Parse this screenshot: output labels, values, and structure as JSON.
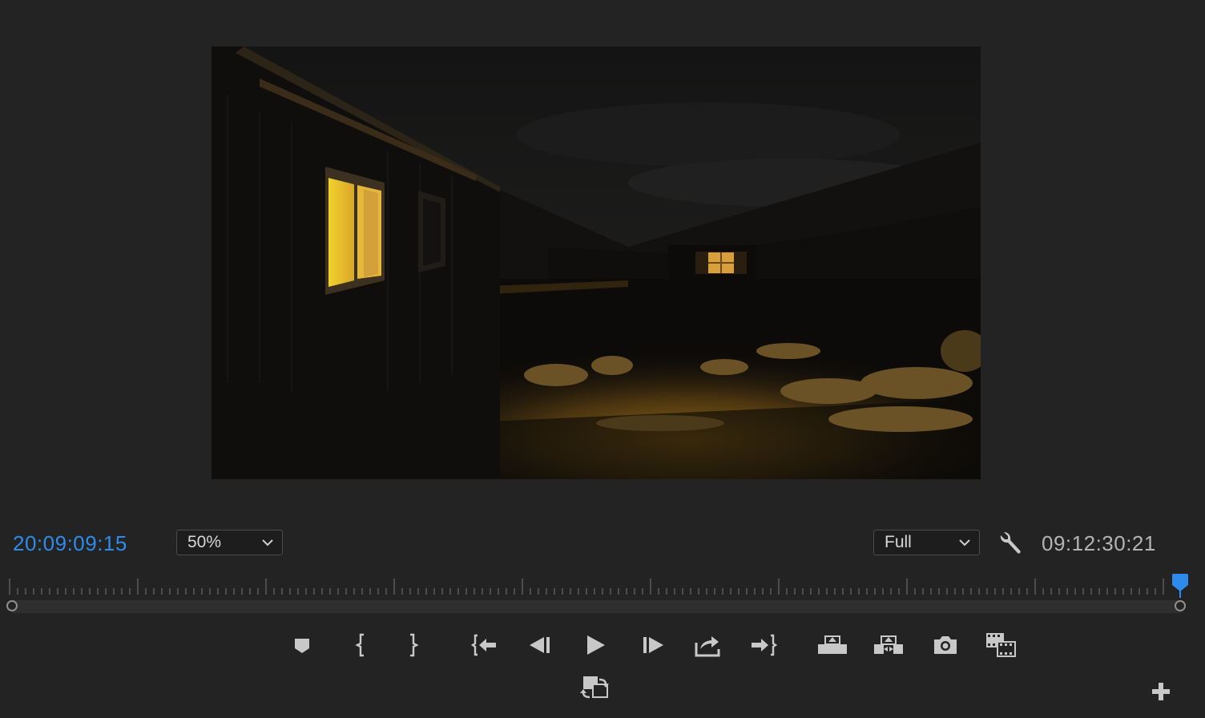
{
  "program_monitor": {
    "current_timecode": "20:09:09:15",
    "duration_timecode": "09:12:30:21",
    "zoom": {
      "selected": "50%"
    },
    "playback_resolution": {
      "selected": "Full"
    },
    "timeline_position": 0.99,
    "colors": {
      "accent": "#2d8ceb",
      "background": "#232323",
      "icon": "#c8c8c8"
    },
    "controls": {
      "row1": [
        "marker-icon",
        "mark-in-icon",
        "mark-out-icon",
        "go-to-in-icon",
        "step-back-icon",
        "play-icon",
        "step-forward-icon",
        "go-to-out-icon",
        "lift-icon",
        "extract-icon",
        "camera-icon",
        "compare-view-icon"
      ],
      "row2": [
        "loop-icon"
      ],
      "extra": "plus-icon"
    }
  }
}
